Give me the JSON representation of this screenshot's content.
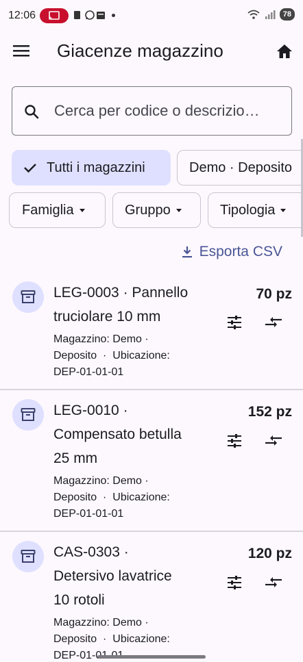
{
  "status_bar": {
    "time": "12:06",
    "battery": "78"
  },
  "app_bar": {
    "title": "Giacenze magazzino",
    "menu_icon": "hamburger-menu-icon",
    "home_icon": "home-icon"
  },
  "search": {
    "placeholder": "Cerca per codice o descrizio…",
    "value": ""
  },
  "warehouse_chips": [
    {
      "label": "Tutti i magazzini",
      "selected": true
    },
    {
      "label": "Demo · Deposito",
      "selected": false
    }
  ],
  "filter_chips": [
    {
      "label": "Famiglia"
    },
    {
      "label": "Gruppo"
    },
    {
      "label": "Tipologia"
    }
  ],
  "export_label": "Esporta CSV",
  "items": [
    {
      "title_line1": "LEG-0003 · Pannello",
      "title_line2": "truciolare 10 mm",
      "title_line3": "",
      "sub_line1": "Magazzino: Demo ·",
      "sub_line2": "Deposito  ·  Ubicazione:",
      "sub_line3": "DEP-01-01-01",
      "qty": "70 pz"
    },
    {
      "title_line1": "LEG-0010 ·",
      "title_line2": "Compensato betulla",
      "title_line3": "25 mm",
      "sub_line1": "Magazzino: Demo ·",
      "sub_line2": "Deposito  ·  Ubicazione:",
      "sub_line3": "DEP-01-01-01",
      "qty": "152 pz"
    },
    {
      "title_line1": "CAS-0303 ·",
      "title_line2": "Detersivo lavatrice",
      "title_line3": "10 rotoli",
      "sub_line1": "Magazzino: Demo ·",
      "sub_line2": "Deposito  ·  Ubicazione:",
      "sub_line3": "DEP-01-01-01",
      "qty": "120 pz"
    }
  ],
  "colors": {
    "background": "#fdf8fd",
    "accent": "#4a5596",
    "selected_chip": "#dfe0ff",
    "cast_pill": "#c8102e"
  }
}
